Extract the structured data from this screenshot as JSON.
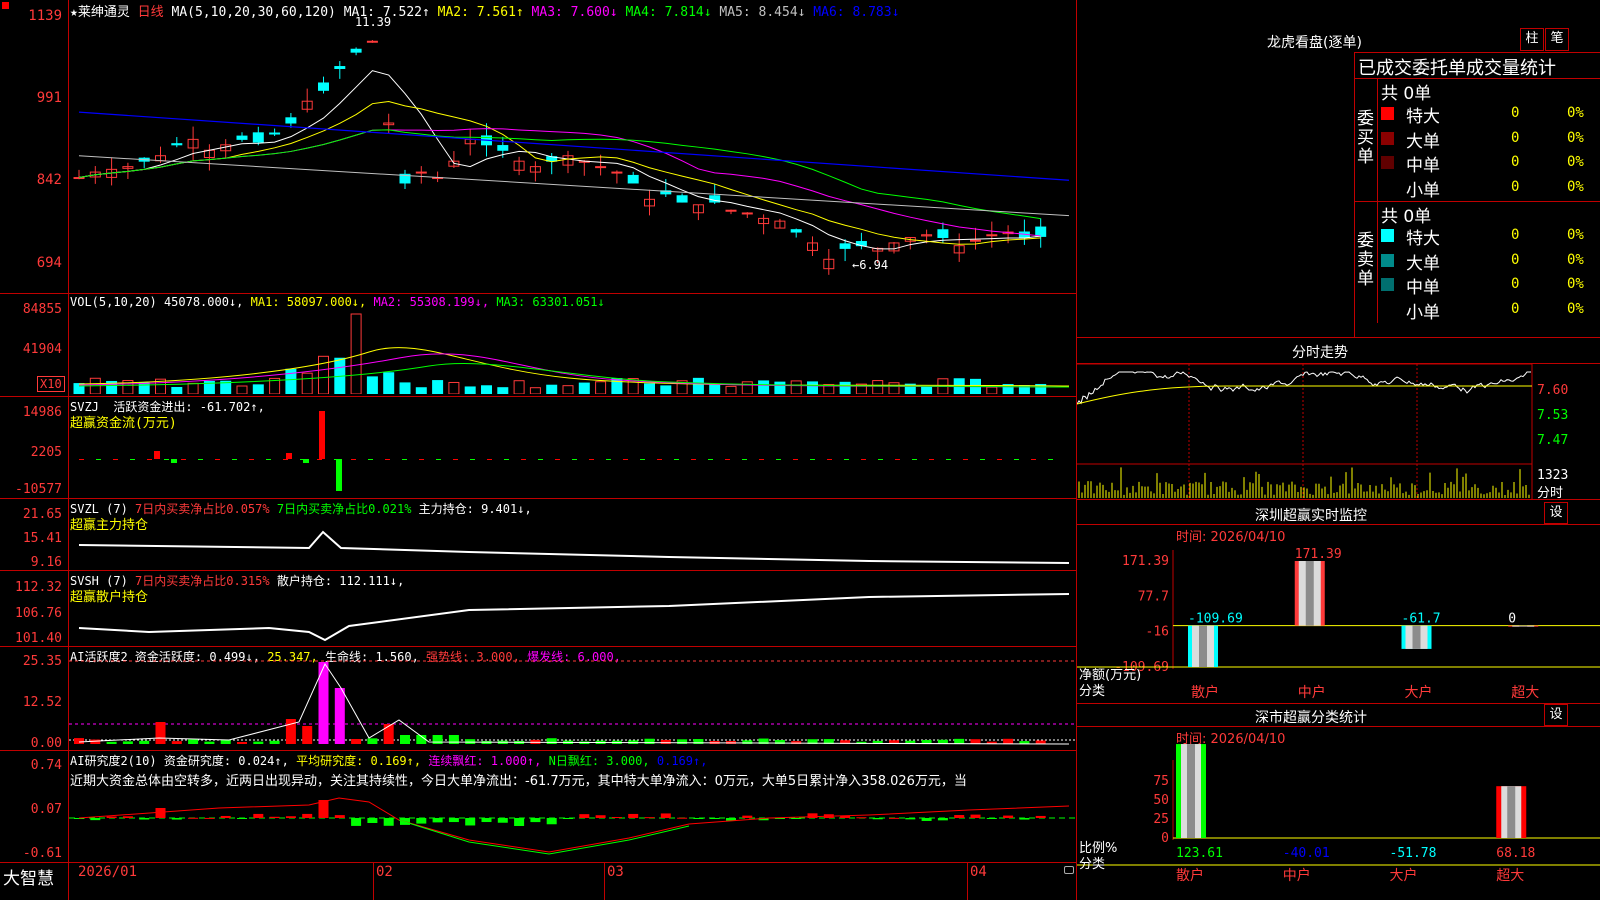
{
  "main_chart": {
    "title": "★莱绅通灵",
    "period": "日线",
    "ma_params": "MA(5,10,20,30,60,120)",
    "ma_values": [
      {
        "label": "MA1: 7.522↑",
        "color": "#ffffff"
      },
      {
        "label": "MA2: 7.561↑",
        "color": "#ffff00"
      },
      {
        "label": "MA3: 7.600↓",
        "color": "#ff00ff"
      },
      {
        "label": "MA4: 7.814↓",
        "color": "#00ff00"
      },
      {
        "label": "MA5: 8.454↓",
        "color": "#c0c0c0"
      },
      {
        "label": "MA6: 8.783↓",
        "color": "#0000ff"
      }
    ],
    "y_ticks": [
      "1139",
      "991",
      "842",
      "694"
    ],
    "high_label": "11.39",
    "low_label": "←6.94"
  },
  "vol_panel": {
    "title": "VOL(5,10,20)",
    "value": "45078.000↓,",
    "ma1": "MA1: 58097.000↓,",
    "ma2": "MA2: 55308.199↓,",
    "ma3": "MA3: 63301.051↓",
    "y_ticks": [
      "84855",
      "41904"
    ],
    "unit": "X10"
  },
  "svzj_panel": {
    "title": "SVZJ",
    "line1": "活跃资金进出: -61.702↑,",
    "line2": "超赢资金流(万元)",
    "y_ticks": [
      "14986",
      "2205",
      "-10577"
    ]
  },
  "svzl_panel": {
    "title": "SVZL (7)",
    "text_a": "7日内买卖净占比0.057%",
    "text_b": "7日内买卖净占比0.021%",
    "text_c": "主力持仓: 9.401↓,",
    "line2": "超赢主力持仓",
    "y_ticks": [
      "21.65",
      "15.41",
      "9.16"
    ]
  },
  "svsh_panel": {
    "title": "SVSH (7)",
    "text_a": "7日内买卖净占比0.315%",
    "text_b": "散户持仓: 112.111↓,",
    "line2": "超赢散户持仓",
    "y_ticks": [
      "112.32",
      "106.76",
      "101.40"
    ]
  },
  "ai_active": {
    "title": "AI活跃度2",
    "v1": "资金活跃度: 0.499↓,",
    "v2": "25.347,",
    "v3": "生命线: 1.560,",
    "v4": "强势线: 3.000,",
    "v5": "爆发线: 6.000,",
    "y_ticks": [
      "25.35",
      "12.52",
      "0.00"
    ]
  },
  "ai_research": {
    "title": "AI研究度2(10)",
    "v1": "资金研究度: 0.024↑,",
    "v2": "平均研究度: 0.169↑,",
    "v3": "连续飘红: 1.000↑,",
    "v4": "N日飘红: 3.000,",
    "v5": "0.169↑,",
    "summary": "近期大资金总体由空转多，近两日出现异动，关注其持续性，今日大单净流出：-61.7万元，其中特大单净流入：0万元，大单5日累计净入358.026万元，当",
    "y_ticks": [
      "0.74",
      "0.07",
      "-0.61"
    ]
  },
  "x_axis": {
    "brand": "大智慧",
    "labels": [
      "2026/01",
      "02",
      "03",
      "04"
    ]
  },
  "lhb": {
    "title": "龙虎看盘(逐单)",
    "btn_bar": "柱",
    "btn_pen": "笔",
    "header": "已成交委托单成交量统计",
    "buy_side": "委买单",
    "sell_side": "委卖单",
    "buy_total": "共 0单",
    "sell_total": "共 0单",
    "buy_rows": [
      {
        "label": "特大",
        "count": "0",
        "pct": "0%",
        "color": "#ff0000"
      },
      {
        "label": "大单",
        "count": "0",
        "pct": "0%",
        "color": "#8b0000"
      },
      {
        "label": "中单",
        "count": "0",
        "pct": "0%",
        "color": "#600000"
      },
      {
        "label": "小单",
        "count": "0",
        "pct": "0%",
        "color": ""
      }
    ],
    "sell_rows": [
      {
        "label": "特大",
        "count": "0",
        "pct": "0%",
        "color": "#00ffff"
      },
      {
        "label": "大单",
        "count": "0",
        "pct": "0%",
        "color": "#008b8b"
      },
      {
        "label": "中单",
        "count": "0",
        "pct": "0%",
        "color": "#006f6f"
      },
      {
        "label": "小单",
        "count": "0",
        "pct": "0%",
        "color": ""
      }
    ]
  },
  "intraday": {
    "title": "分时走势",
    "y_ticks": [
      "7.60",
      "7.53",
      "7.47"
    ],
    "vol_max": "1323",
    "vol_label": "分时"
  },
  "sz_monitor": {
    "title": "深圳超赢实时监控",
    "btn": "设",
    "time": "时间: 2026/04/10",
    "y_ticks": [
      "171.39",
      "77.7",
      "-16",
      "-109.69"
    ],
    "y_title": "净额(万元)",
    "x_title": "分类",
    "categories": [
      "散户",
      "中户",
      "大户",
      "超大"
    ],
    "chart_data": {
      "type": "bar",
      "categories": [
        "散户",
        "中户",
        "大户",
        "超大"
      ],
      "values": [
        -109.69,
        171.39,
        -61.7,
        0
      ],
      "value_labels": [
        "-109.69",
        "171.39",
        "-61.7",
        "0"
      ],
      "ylabel": "净额(万元)",
      "ylim": [
        -109.69,
        171.39
      ]
    }
  },
  "sz_stats": {
    "title": "深市超赢分类统计",
    "btn": "设",
    "time": "时间: 2026/04/10",
    "y_ticks": [
      "75",
      "50",
      "25",
      "0"
    ],
    "y_title": "比例%",
    "x_title": "分类",
    "categories": [
      "散户",
      "中户",
      "大户",
      "超大"
    ],
    "chart_data": {
      "type": "bar",
      "categories": [
        "散户",
        "中户",
        "大户",
        "超大"
      ],
      "values": [
        123.61,
        -40.01,
        -51.78,
        68.18
      ],
      "value_labels": [
        "123.61",
        "-40.01",
        "-51.78",
        "68.18"
      ],
      "ylabel": "比例%",
      "ylim": [
        0,
        75
      ]
    }
  }
}
